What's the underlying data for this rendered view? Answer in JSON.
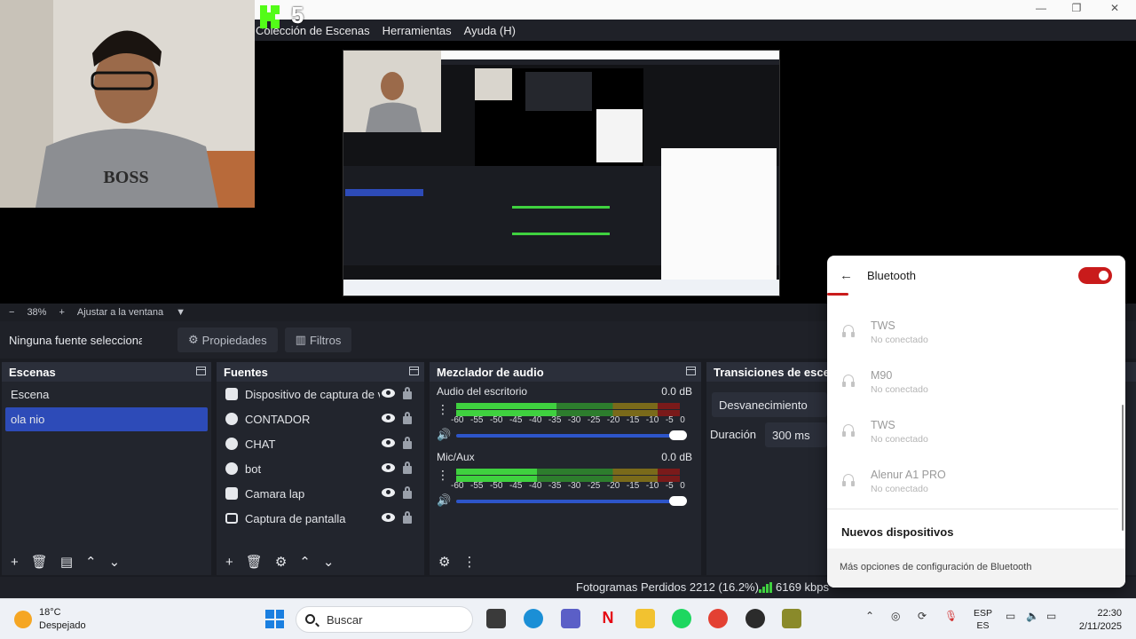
{
  "menu": [
    "Colección de Escenas",
    "Herramientas",
    "Ayuda (H)"
  ],
  "logo_number": "5",
  "zoom": {
    "minus": "−",
    "value": "38%",
    "plus": "+",
    "fit": "Ajustar a la ventana"
  },
  "source_bar": {
    "none": "Ninguna fuente seleccionada",
    "properties": "Propiedades",
    "filters": "Filtros"
  },
  "scenes": {
    "title": "Escenas",
    "items": [
      "Escena",
      "ola nio"
    ],
    "selected": 1
  },
  "sources": {
    "title": "Fuentes",
    "items": [
      {
        "label": "Dispositivo de captura de video",
        "icon": "camera-icon"
      },
      {
        "label": "CONTADOR",
        "icon": "browser-icon"
      },
      {
        "label": "CHAT",
        "icon": "browser-icon"
      },
      {
        "label": "bot",
        "icon": "browser-icon"
      },
      {
        "label": "Camara lap",
        "icon": "camera-icon"
      },
      {
        "label": "Captura de pantalla",
        "icon": "monitor-icon"
      }
    ]
  },
  "mixer": {
    "title": "Mezclador de audio",
    "channels": [
      {
        "name": "Audio del escritorio",
        "db": "0.0 dB",
        "level": 0.45
      },
      {
        "name": "Mic/Aux",
        "db": "0.0 dB",
        "level": 0.36
      }
    ],
    "scale": [
      "-60",
      "-55",
      "-50",
      "-45",
      "-40",
      "-35",
      "-30",
      "-25",
      "-20",
      "-15",
      "-10",
      "-5",
      "0"
    ]
  },
  "transitions": {
    "title": "Transiciones de escenas",
    "type": "Desvanecimiento",
    "duration_label": "Duración",
    "duration": "300 ms"
  },
  "status": {
    "frames_lost": "Fotogramas Perdidos 2212 (16.2%)",
    "kbps": "6169 kbps"
  },
  "bluetooth": {
    "title": "Bluetooth",
    "enabled": true,
    "devices": [
      {
        "name": "TWS",
        "status": "No conectado"
      },
      {
        "name": "M90",
        "status": "No conectado"
      },
      {
        "name": "TWS",
        "status": "No conectado"
      },
      {
        "name": "Alenur A1 PRO",
        "status": "No conectado"
      }
    ],
    "new_devices": "Nuevos dispositivos",
    "more_options": "Más opciones de configuración de Bluetooth"
  },
  "taskbar": {
    "weather": {
      "temp": "18°C",
      "condition": "Despejado"
    },
    "search_placeholder": "Buscar",
    "lang": {
      "line1": "ESP",
      "line2": "ES"
    },
    "time": "22:30",
    "date": "2/11/2025"
  },
  "colors": {
    "accent": "#2d4bb8",
    "bt_toggle": "#c91b1b",
    "meter_green": "#3fd13f"
  }
}
